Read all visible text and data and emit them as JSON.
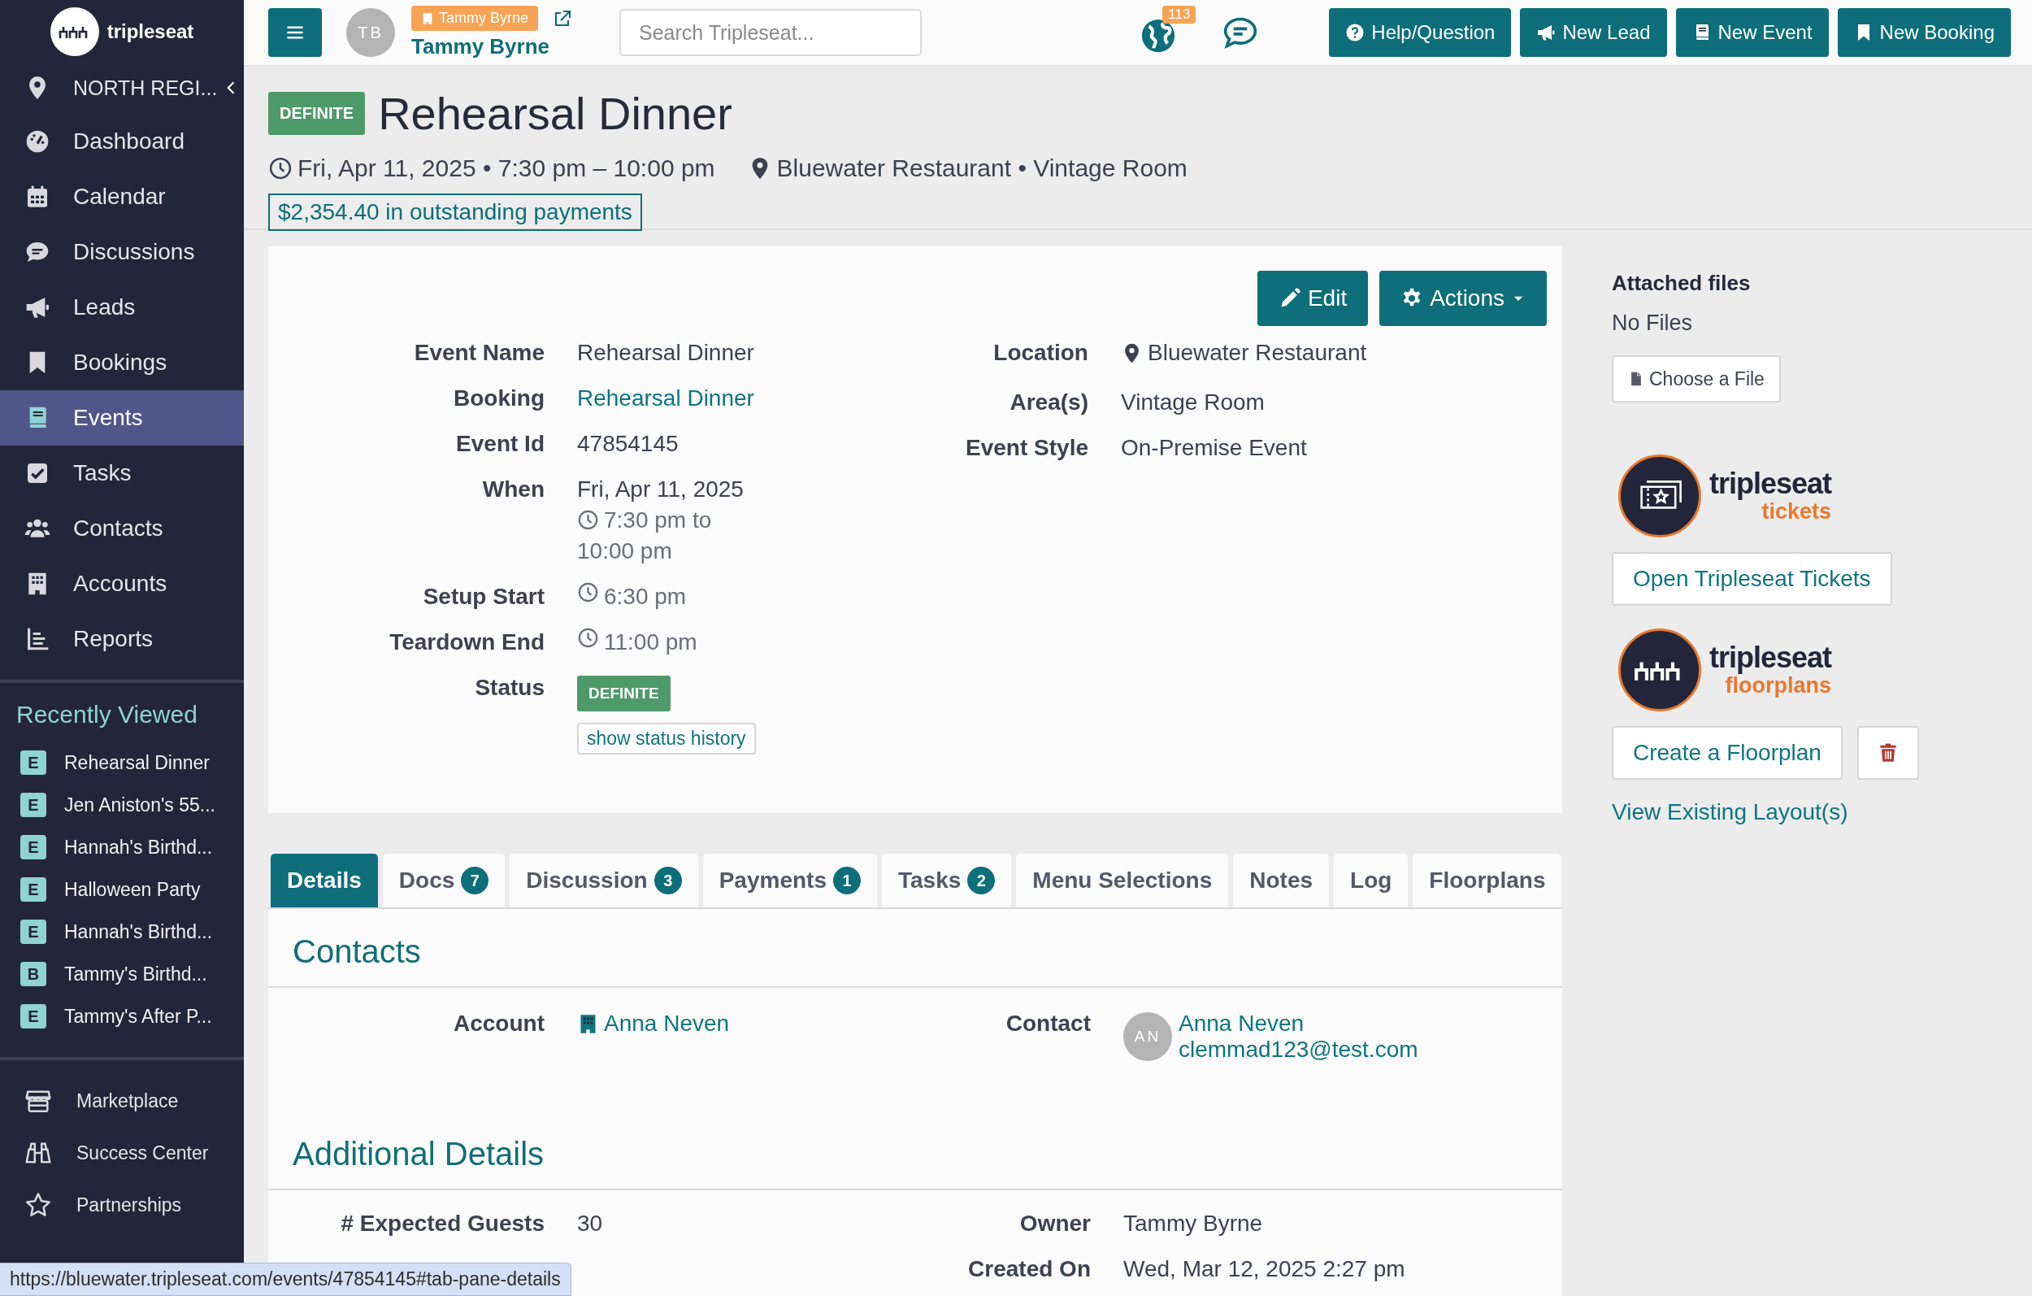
{
  "sidebar": {
    "brand": "tripleseat",
    "location": "NORTH REGI...",
    "nav": [
      {
        "label": "Dashboard",
        "selected": false
      },
      {
        "label": "Calendar",
        "selected": false
      },
      {
        "label": "Discussions",
        "selected": false
      },
      {
        "label": "Leads",
        "selected": false
      },
      {
        "label": "Bookings",
        "selected": false
      },
      {
        "label": "Events",
        "selected": true
      },
      {
        "label": "Tasks",
        "selected": false
      },
      {
        "label": "Contacts",
        "selected": false
      },
      {
        "label": "Accounts",
        "selected": false
      },
      {
        "label": "Reports",
        "selected": false
      }
    ],
    "recent_title": "Recently Viewed",
    "recent": [
      {
        "letter": "E",
        "label": "Rehearsal Dinner"
      },
      {
        "letter": "E",
        "label": "Jen Aniston's 55..."
      },
      {
        "letter": "E",
        "label": "Hannah's Birthd..."
      },
      {
        "letter": "E",
        "label": "Halloween Party"
      },
      {
        "letter": "E",
        "label": "Hannah's Birthd..."
      },
      {
        "letter": "B",
        "label": "Tammy's Birthd..."
      },
      {
        "letter": "E",
        "label": "Tammy's After P..."
      }
    ],
    "footer_nav": [
      {
        "label": "Marketplace"
      },
      {
        "label": "Success Center"
      },
      {
        "label": "Partnerships"
      }
    ]
  },
  "topbar": {
    "avatar": "TB",
    "user_badge": "Tammy Byrne",
    "user_name": "Tammy Byrne",
    "search": {
      "placeholder": "Search Tripleseat..."
    },
    "notification_count": "113",
    "buttons": [
      {
        "label": "Help/Question"
      },
      {
        "label": "New Lead"
      },
      {
        "label": "New Event"
      },
      {
        "label": "New Booking"
      }
    ]
  },
  "event": {
    "status": "DEFINITE",
    "title": "Rehearsal Dinner",
    "datetime": "Fri, Apr 11, 2025 • 7:30 pm – 10:00 pm",
    "venue": "Bluewater Restaurant • Vintage Room",
    "outstanding": "$2,354.40 in outstanding payments"
  },
  "details": {
    "buttons": [
      {
        "label": "Edit",
        "kind": "button"
      },
      {
        "label": "Actions",
        "kind": "dropdown"
      }
    ],
    "left": [
      {
        "label": "Event Name",
        "kind": "text",
        "value": "Rehearsal Dinner"
      },
      {
        "label": "Booking",
        "kind": "link",
        "value": "Rehearsal Dinner"
      },
      {
        "label": "Event Id",
        "kind": "text",
        "value": "47854145"
      },
      {
        "label": "When",
        "kind": "when",
        "value": "Fri, Apr 11, 2025",
        "time": "7:30 pm to 10:00 pm"
      },
      {
        "label": "Setup Start",
        "kind": "time",
        "value": "6:30 pm"
      },
      {
        "label": "Teardown End",
        "kind": "time",
        "value": "11:00 pm"
      },
      {
        "label": "Status",
        "kind": "status",
        "value": "DEFINITE",
        "button": "show status history"
      }
    ],
    "right": [
      {
        "label": "Location",
        "kind": "location",
        "value": "Bluewater Restaurant"
      },
      {
        "label": "Area(s)",
        "kind": "text",
        "value": "Vintage Room"
      },
      {
        "label": "Event Style",
        "kind": "text",
        "value": "On-Premise Event"
      }
    ]
  },
  "side_panel": {
    "files_title": "Attached files",
    "files_empty": "No Files",
    "choose_button": "Choose a File",
    "tickets": {
      "brand": "tripleseat",
      "product": "tickets",
      "button": "Open Tripleseat Tickets"
    },
    "floorplans": {
      "brand": "tripleseat",
      "product": "floorplans",
      "button": "Create a Floorplan",
      "link": "View Existing Layout(s)"
    }
  },
  "tabs": [
    {
      "label": "Details",
      "selected": true
    },
    {
      "label": "Docs",
      "count": "7",
      "selected": false
    },
    {
      "label": "Discussion",
      "count": "3",
      "selected": false
    },
    {
      "label": "Payments",
      "count": "1",
      "selected": false
    },
    {
      "label": "Tasks",
      "count": "2",
      "selected": false
    },
    {
      "label": "Menu Selections",
      "selected": false
    },
    {
      "label": "Notes",
      "selected": false
    },
    {
      "label": "Log",
      "selected": false
    },
    {
      "label": "Floorplans",
      "selected": false
    }
  ],
  "contacts": {
    "title": "Contacts",
    "account_label": "Account",
    "account": "Anna Neven",
    "contact_label": "Contact",
    "contact_avatar": "AN",
    "contact_name": "Anna Neven",
    "contact_email": "clemmad123@test.com"
  },
  "additional": {
    "title": "Additional Details",
    "left": [
      {
        "label": "# Expected Guests",
        "kind": "text",
        "value": "30"
      }
    ],
    "right": [
      {
        "label": "Owner",
        "kind": "text",
        "value": "Tammy Byrne"
      },
      {
        "label": "Created On",
        "kind": "text",
        "value": "Wed, Mar 12, 2025 2:27 pm"
      }
    ]
  },
  "status_bar": {
    "url": "https://bluewater.tripleseat.com/events/47854145#tab-pane-details"
  }
}
